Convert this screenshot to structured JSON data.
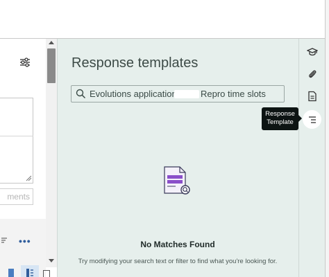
{
  "panel": {
    "title": "Response templates",
    "search": {
      "value_before_mask": "Evolutions application",
      "value_after_mask": "Repro time slots"
    },
    "empty_state": {
      "title": "No Matches Found",
      "message": "Try modifying your search text or filter to find what you're looking for."
    }
  },
  "editor": {
    "comments_button_label": "ments",
    "more_label": "•••"
  },
  "rail": {
    "icons": [
      "graduation-cap-icon",
      "paperclip-icon",
      "document-icon",
      "response-template-icon"
    ],
    "active": "response-template-icon",
    "tooltip": "Response Template"
  },
  "colors": {
    "panel_bg": "#e6efec",
    "illustration_accent": "#8a4fc9",
    "link_blue": "#2f5d9c"
  }
}
